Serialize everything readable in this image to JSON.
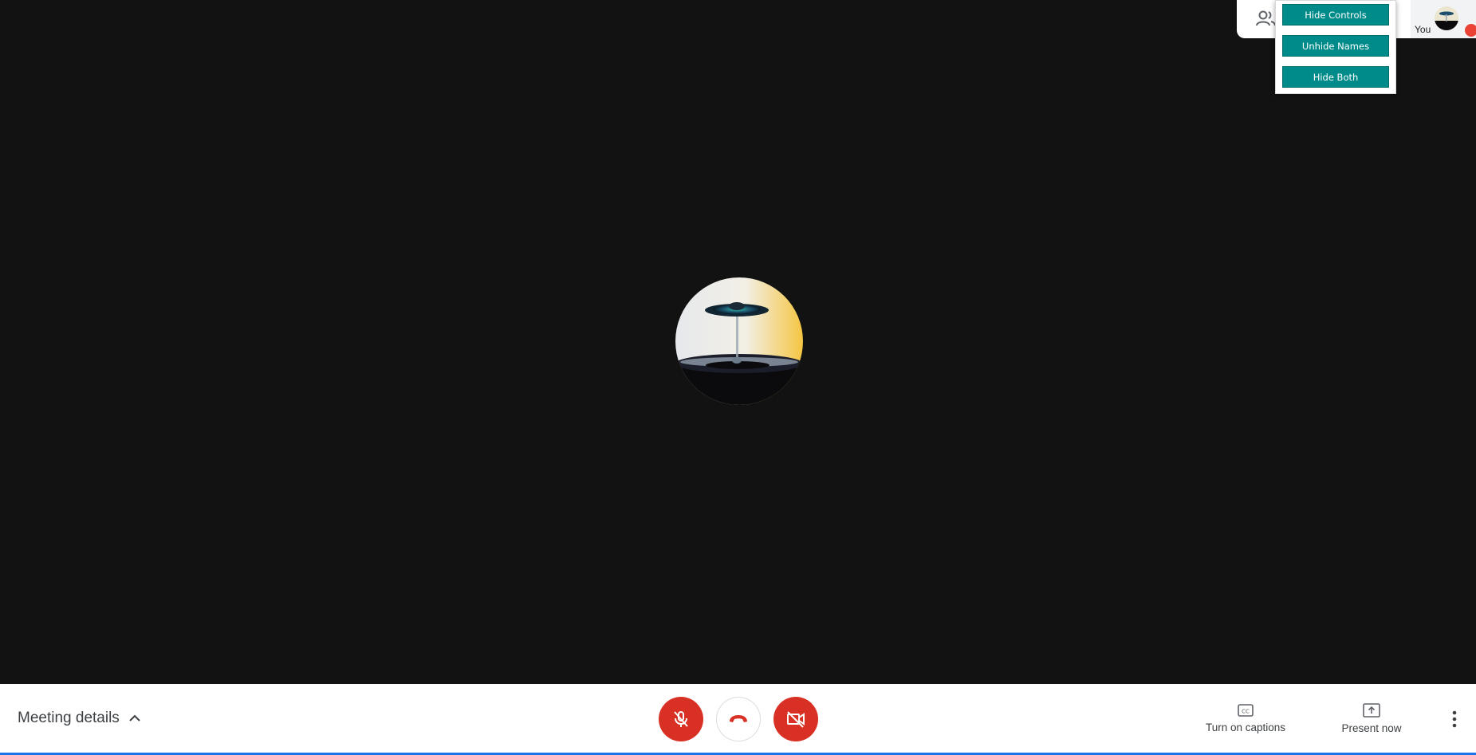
{
  "colors": {
    "stage_bg": "#121212",
    "danger": "#d93025",
    "teal": "#008b8b",
    "record": "#ea4335",
    "accent": "#1a73e8"
  },
  "extension_panel": {
    "hide_controls": "Hide Controls",
    "unhide_names": "Unhide Names",
    "hide_both": "Hide Both"
  },
  "participants": {
    "self_label": "You",
    "icon": "people-icon"
  },
  "bottom_bar": {
    "meeting_details": "Meeting details",
    "captions_label": "Turn on captions",
    "present_label": "Present now",
    "mic_state": "muted",
    "camera_state": "off",
    "icons": [
      "mic-off-icon",
      "hang-up-icon",
      "camera-off-icon",
      "captions-icon",
      "present-icon",
      "more-vert-icon",
      "chevron-up-icon"
    ]
  }
}
